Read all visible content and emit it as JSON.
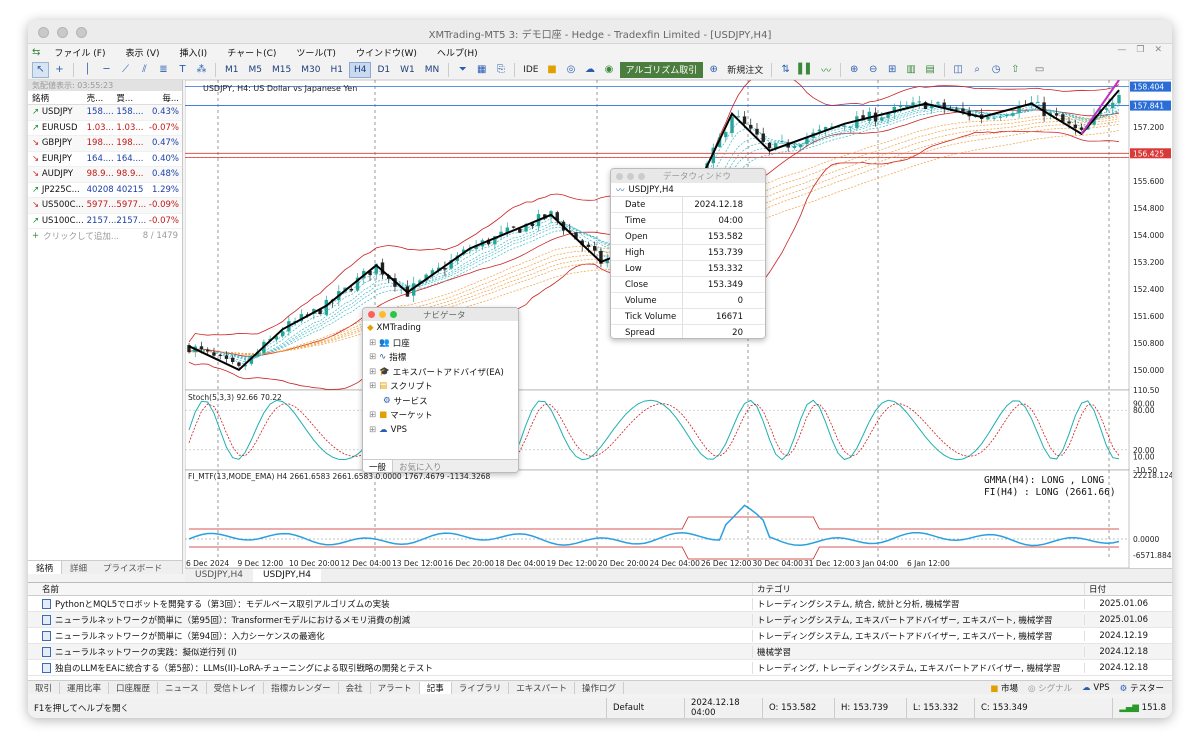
{
  "window": {
    "title": "XMTrading-MT5 3: デモ口座 - Hedge - Tradexfin Limited - [USDJPY,H4]"
  },
  "menu": [
    "ファイル (F)",
    "表示 (V)",
    "挿入(I)",
    "チャート(C)",
    "ツール(T)",
    "ウインドウ(W)",
    "ヘルプ(H)"
  ],
  "toolbar": {
    "timeframes": [
      "M1",
      "M5",
      "M15",
      "M30",
      "H1",
      "H4",
      "D1",
      "W1",
      "MN"
    ],
    "selected_timeframe": "H4",
    "ide": "IDE",
    "algo_label": "アルゴリズム取引",
    "new_order_label": "新規注文"
  },
  "market_watch": {
    "header": "気配値表示: 03:55:23",
    "columns": [
      "銘柄",
      "売...",
      "買...",
      "毎..."
    ],
    "rows": [
      {
        "symbol": "USDJPY",
        "bid": "158....",
        "ask": "158....",
        "change": "0.43%",
        "dir": "up",
        "price_color": "blue",
        "change_sign": "pos"
      },
      {
        "symbol": "EURUSD",
        "bid": "1.03...",
        "ask": "1.03...",
        "change": "-0.07%",
        "dir": "up",
        "price_color": "red",
        "change_sign": "neg"
      },
      {
        "symbol": "GBPJPY",
        "bid": "198....",
        "ask": "198....",
        "change": "0.47%",
        "dir": "dn",
        "price_color": "red",
        "change_sign": "pos"
      },
      {
        "symbol": "EURJPY",
        "bid": "164....",
        "ask": "164....",
        "change": "0.40%",
        "dir": "dn",
        "price_color": "blue",
        "change_sign": "pos"
      },
      {
        "symbol": "AUDJPY",
        "bid": "98.9...",
        "ask": "98.9...",
        "change": "0.48%",
        "dir": "dn",
        "price_color": "red",
        "change_sign": "pos"
      },
      {
        "symbol": "JP225C...",
        "bid": "40208",
        "ask": "40215",
        "change": "1.29%",
        "dir": "up",
        "price_color": "blue",
        "change_sign": "pos"
      },
      {
        "symbol": "US500C...",
        "bid": "5977....",
        "ask": "5977....",
        "change": "-0.09%",
        "dir": "dn",
        "price_color": "red",
        "change_sign": "neg"
      },
      {
        "symbol": "US100C...",
        "bid": "2157...",
        "ask": "2157...",
        "change": "-0.07%",
        "dir": "up",
        "price_color": "blue",
        "change_sign": "neg"
      }
    ],
    "add_label": "クリックして追加...",
    "count": "8 / 1479",
    "tabs": [
      "銘柄",
      "詳細",
      "プライスボード"
    ]
  },
  "chart": {
    "header": "USDJPY, H4:  US Dollar vs Japanese Yen",
    "price_labels": [
      "158.404",
      "157.841",
      "157.200",
      "156.425",
      "155.600",
      "154.800",
      "154.000",
      "153.200",
      "152.400",
      "151.600",
      "150.800",
      "150.000"
    ],
    "stoch_label": "Stoch(5,3,3) 92.66 70.22",
    "stoch_levels": [
      "110.50",
      "90.00",
      "80.00",
      "20.00",
      "10.00",
      "-10.50"
    ],
    "fi_label": "FI_MTF(13,MODE_EMA) H4 2661.6583 2661.6583 0.0000 1767.4679 -1134.3268",
    "fi_levels": [
      "22218.1246",
      "0.0000",
      "-6571.8848"
    ],
    "gmma_text": "GMMA(H4): LONG , LONG",
    "fi_text": "FI(H4)  : LONG (2661.66)",
    "time_labels": [
      "6 Dec 2024",
      "9 Dec 12:00",
      "10 Dec 20:00",
      "12 Dec 04:00",
      "13 Dec 12:00",
      "16 Dec 20:00",
      "18 Dec 04:00",
      "19 Dec 12:00",
      "20 Dec 20:00",
      "24 Dec 04:00",
      "26 Dec 12:00",
      "30 Dec 04:00",
      "31 Dec 12:00",
      "3 Jan 04:00",
      "6 Jan 12:00"
    ],
    "tabs": [
      "USDJPY,H4",
      "USDJPY,H4"
    ]
  },
  "data_window": {
    "title": "データウィンドウ",
    "symbol": "USDJPY,H4",
    "rows": [
      {
        "k": "Date",
        "v": "2024.12.18"
      },
      {
        "k": "Time",
        "v": "04:00"
      },
      {
        "k": "Open",
        "v": "153.582"
      },
      {
        "k": "High",
        "v": "153.739"
      },
      {
        "k": "Low",
        "v": "153.332"
      },
      {
        "k": "Close",
        "v": "153.349"
      },
      {
        "k": "Volume",
        "v": "0"
      },
      {
        "k": "Tick Volume",
        "v": "16671"
      },
      {
        "k": "Spread",
        "v": "20"
      }
    ]
  },
  "navigator": {
    "title": "ナビゲータ",
    "root": "XMTrading",
    "items": [
      "口座",
      "指標",
      "エキスパートアドバイザ(EA)",
      "スクリプト",
      "サービス",
      "マーケット",
      "VPS"
    ],
    "tabs": [
      "一般",
      "お気に入り"
    ]
  },
  "toolbox": {
    "columns": [
      "名前",
      "カテゴリ",
      "日付"
    ],
    "rows": [
      {
        "name": "PythonとMQL5でロボットを開発する（第3回）：モデルベース取引アルゴリズムの実装",
        "cat": "トレーディングシステム, 統合, 統計と分析, 機械学習",
        "date": "2025.01.06"
      },
      {
        "name": "ニューラルネットワークが簡単に（第95回）：Transformerモデルにおけるメモリ消費の削減",
        "cat": "トレーディングシステム, エキスパートアドバイザー, エキスパート, 機械学習",
        "date": "2025.01.06"
      },
      {
        "name": "ニューラルネットワークが簡単に（第94回）：入力シーケンスの最適化",
        "cat": "トレーディングシステム, エキスパートアドバイザー, エキスパート, 機械学習",
        "date": "2024.12.19"
      },
      {
        "name": "ニューラルネットワークの実践：擬似逆行列 (I)",
        "cat": "機械学習",
        "date": "2024.12.18"
      },
      {
        "name": "独自のLLMをEAに統合する（第5部）：LLMs(II)-LoRA-チューニングによる取引戦略の開発とテスト",
        "cat": "トレーディング, トレーディングシステム, エキスパートアドバイザー, 機械学習",
        "date": "2024.12.18"
      }
    ],
    "tabs": [
      "取引",
      "運用比率",
      "口座履歴",
      "ニュース",
      "受信トレイ",
      "指標カレンダー",
      "会社",
      "アラート",
      "記事",
      "ライブラリ",
      "エキスパート",
      "操作ログ"
    ],
    "active_tab": "記事",
    "right": [
      "市場",
      "シグナル",
      "VPS",
      "テスター"
    ]
  },
  "status": {
    "help": "F1を押してヘルプを開く",
    "profile": "Default",
    "datetime": "2024.12.18 04:00",
    "open": "O: 153.582",
    "high": "H: 153.739",
    "low": "L: 153.332",
    "close": "C: 153.349",
    "ping": "151.8"
  },
  "colors": {
    "bull": "#26a69a",
    "bear": "#222222",
    "zigzag": "#000000",
    "bollinger": "#cc2020",
    "stoch_main": "#20b0b0",
    "stoch_signal": "#cc2020",
    "fi": "#2aa0e0",
    "algo_btn": "#4a7d3e"
  }
}
